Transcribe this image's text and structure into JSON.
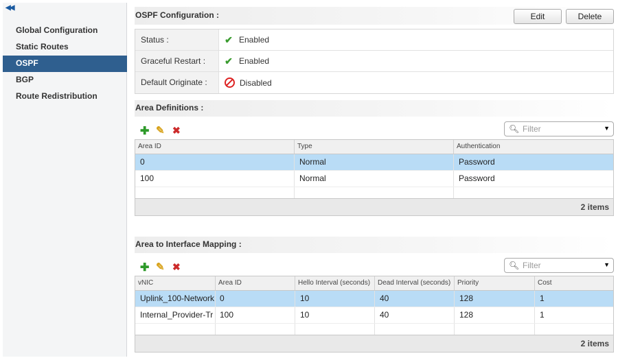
{
  "sidebar": {
    "items": [
      {
        "label": "Global Configuration"
      },
      {
        "label": "Static Routes"
      },
      {
        "label": "OSPF"
      },
      {
        "label": "BGP"
      },
      {
        "label": "Route Redistribution"
      }
    ]
  },
  "ospf": {
    "title": "OSPF Configuration :",
    "edit_label": "Edit",
    "delete_label": "Delete",
    "rows": [
      {
        "label": "Status :",
        "value": "Enabled",
        "icon": "check-icon"
      },
      {
        "label": "Graceful Restart :",
        "value": "Enabled",
        "icon": "check-icon"
      },
      {
        "label": "Default Originate :",
        "value": "Disabled",
        "icon": "disabled-icon"
      }
    ]
  },
  "areas": {
    "title": "Area Definitions :",
    "filter_placeholder": "Filter",
    "columns": [
      "Area ID",
      "Type",
      "Authentication"
    ],
    "rows": [
      [
        "0",
        "Normal",
        "Password"
      ],
      [
        "100",
        "Normal",
        "Password"
      ]
    ],
    "count": "2 items"
  },
  "mapping": {
    "title": "Area to Interface Mapping :",
    "filter_placeholder": "Filter",
    "columns": [
      "vNIC",
      "Area ID",
      "Hello Interval (seconds)",
      "Dead Interval (seconds)",
      "Priority",
      "Cost"
    ],
    "rows": [
      [
        "Uplink_100-Network",
        "0",
        "10",
        "40",
        "128",
        "1"
      ],
      [
        "Internal_Provider-Tr",
        "100",
        "10",
        "40",
        "128",
        "1"
      ]
    ],
    "count": "2 items"
  },
  "colors": {
    "selected_nav": "#2f5f8f",
    "selected_row": "#b9dcf6",
    "enabled": "#3a9c2f",
    "disabled": "#dd2222"
  }
}
